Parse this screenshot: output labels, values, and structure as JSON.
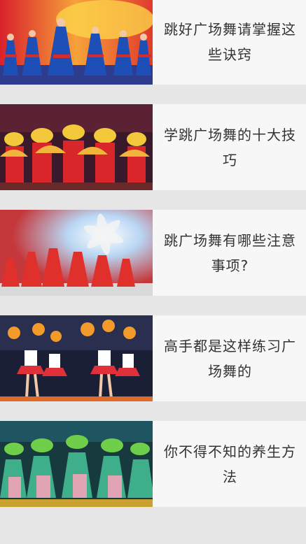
{
  "articles": [
    {
      "title": "跳好广场舞请掌握这些诀窍",
      "thumb": "dancers-blue-red-stage-image"
    },
    {
      "title": "学跳广场舞的十大技巧",
      "thumb": "dancers-yellow-red-fans-image"
    },
    {
      "title": "跳广场舞有哪些注意事项?",
      "thumb": "dancers-red-flower-stage-image"
    },
    {
      "title": "高手都是这样练习广场舞的",
      "thumb": "dancers-cheer-pompoms-image"
    },
    {
      "title": "你不得不知的养生方法",
      "thumb": "dancers-green-costumes-image"
    }
  ]
}
